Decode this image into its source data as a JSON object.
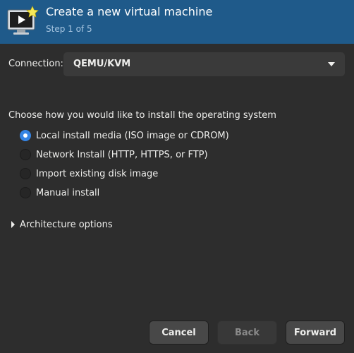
{
  "header": {
    "title": "Create a new virtual machine",
    "subtitle": "Step 1 of 5",
    "icon": "vm-monitor-star-icon"
  },
  "connection": {
    "label": "Connection:",
    "value": "QEMU/KVM"
  },
  "install": {
    "heading": "Choose how you would like to install the operating system",
    "options": [
      {
        "label": "Local install media (ISO image or CDROM)",
        "checked": true
      },
      {
        "label": "Network Install (HTTP, HTTPS, or FTP)",
        "checked": false
      },
      {
        "label": "Import existing disk image",
        "checked": false
      },
      {
        "label": "Manual install",
        "checked": false
      }
    ]
  },
  "architecture": {
    "label": "Architecture options"
  },
  "buttons": {
    "cancel": "Cancel",
    "back": "Back",
    "forward": "Forward"
  },
  "colors": {
    "header_bg": "#1f5a8a",
    "accent": "#3584e4",
    "window_bg": "#2d2d2d"
  }
}
